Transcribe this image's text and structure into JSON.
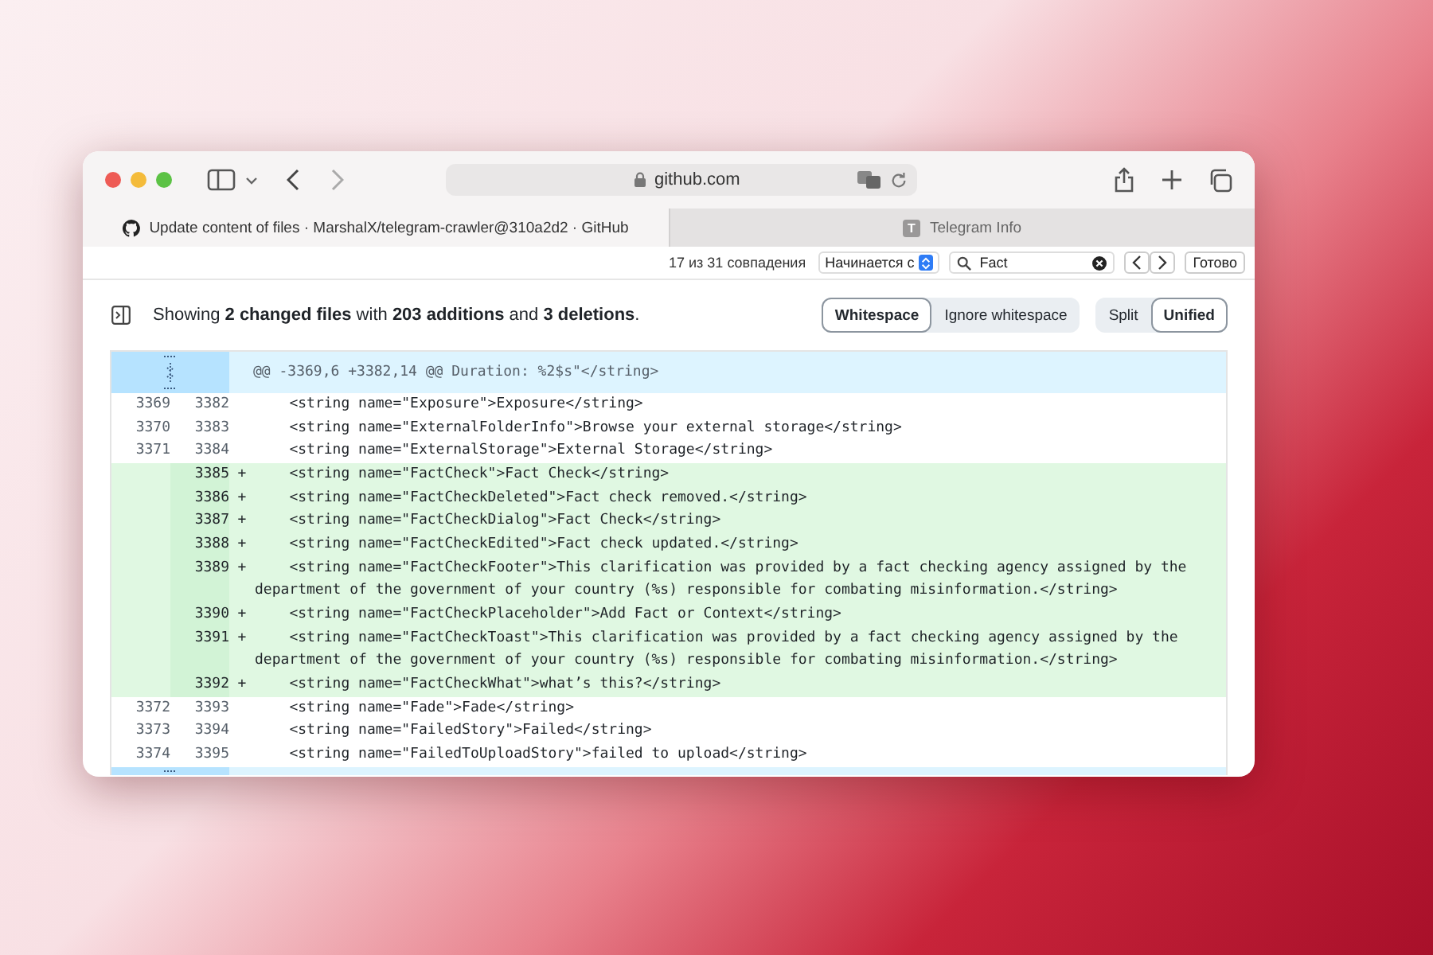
{
  "browser": {
    "url": "github.com",
    "tabs": [
      {
        "title": "Update content of files · MarshalX/telegram-crawler@310a2d2 · GitHub",
        "selected": true,
        "kind": "github"
      },
      {
        "title": "Telegram Info",
        "selected": false,
        "kind": "letter",
        "letter": "T"
      }
    ],
    "find_bar": {
      "count": "17 из 31 совпадения",
      "mode": "Начинается с",
      "query": "Fact",
      "done": "Готово"
    }
  },
  "diff": {
    "summary": "Showing **2 changed files** with **203 additions** and **3 deletions**.",
    "whitespace_buttons": [
      {
        "label": "Whitespace",
        "selected": true
      },
      {
        "label": "Ignore whitespace",
        "selected": false
      }
    ],
    "view_buttons": [
      {
        "label": "Split",
        "selected": false
      },
      {
        "label": "Unified",
        "selected": true
      }
    ],
    "hunk_header": "@@ -3369,6 +3382,14 @@ Duration: %2$s\"</string>",
    "lines": [
      {
        "kind": "context",
        "old": "3369",
        "new": "3382",
        "code": "    <string name=\"Exposure\">Exposure</string>"
      },
      {
        "kind": "context",
        "old": "3370",
        "new": "3383",
        "code": "    <string name=\"ExternalFolderInfo\">Browse your external storage</string>"
      },
      {
        "kind": "context",
        "old": "3371",
        "new": "3384",
        "code": "    <string name=\"ExternalStorage\">External Storage</string>"
      },
      {
        "kind": "addition",
        "new": "3385",
        "marker": "+",
        "code": "    <string name=\"FactCheck\">Fact Check</string>"
      },
      {
        "kind": "addition",
        "new": "3386",
        "marker": "+",
        "code": "    <string name=\"FactCheckDeleted\">Fact check removed.</string>"
      },
      {
        "kind": "addition",
        "new": "3387",
        "marker": "+",
        "code": "    <string name=\"FactCheckDialog\">Fact Check</string>"
      },
      {
        "kind": "addition",
        "new": "3388",
        "marker": "+",
        "code": "    <string name=\"FactCheckEdited\">Fact check updated.</string>"
      },
      {
        "kind": "addition",
        "new": "3389",
        "marker": "+",
        "code": "    <string name=\"FactCheckFooter\">This clarification was provided by a fact checking agency assigned by the department of the government of your country (%s) responsible for combating misinformation.</string>"
      },
      {
        "kind": "addition",
        "new": "3390",
        "marker": "+",
        "code": "    <string name=\"FactCheckPlaceholder\">Add Fact or Context</string>"
      },
      {
        "kind": "addition",
        "new": "3391",
        "marker": "+",
        "code": "    <string name=\"FactCheckToast\">This clarification was provided by a fact checking agency assigned by the department of the government of your country (%s) responsible for combating misinformation.</string>"
      },
      {
        "kind": "addition",
        "new": "3392",
        "marker": "+",
        "code": "    <string name=\"FactCheckWhat\">what’s this?</string>"
      },
      {
        "kind": "context",
        "old": "3372",
        "new": "3393",
        "code": "    <string name=\"Fade\">Fade</string>"
      },
      {
        "kind": "context",
        "old": "3373",
        "new": "3394",
        "code": "    <string name=\"FailedStory\">Failed</string>"
      },
      {
        "kind": "context",
        "old": "3374",
        "new": "3395",
        "code": "    <string name=\"FailedToUploadStory\">failed to upload</string>"
      }
    ]
  }
}
